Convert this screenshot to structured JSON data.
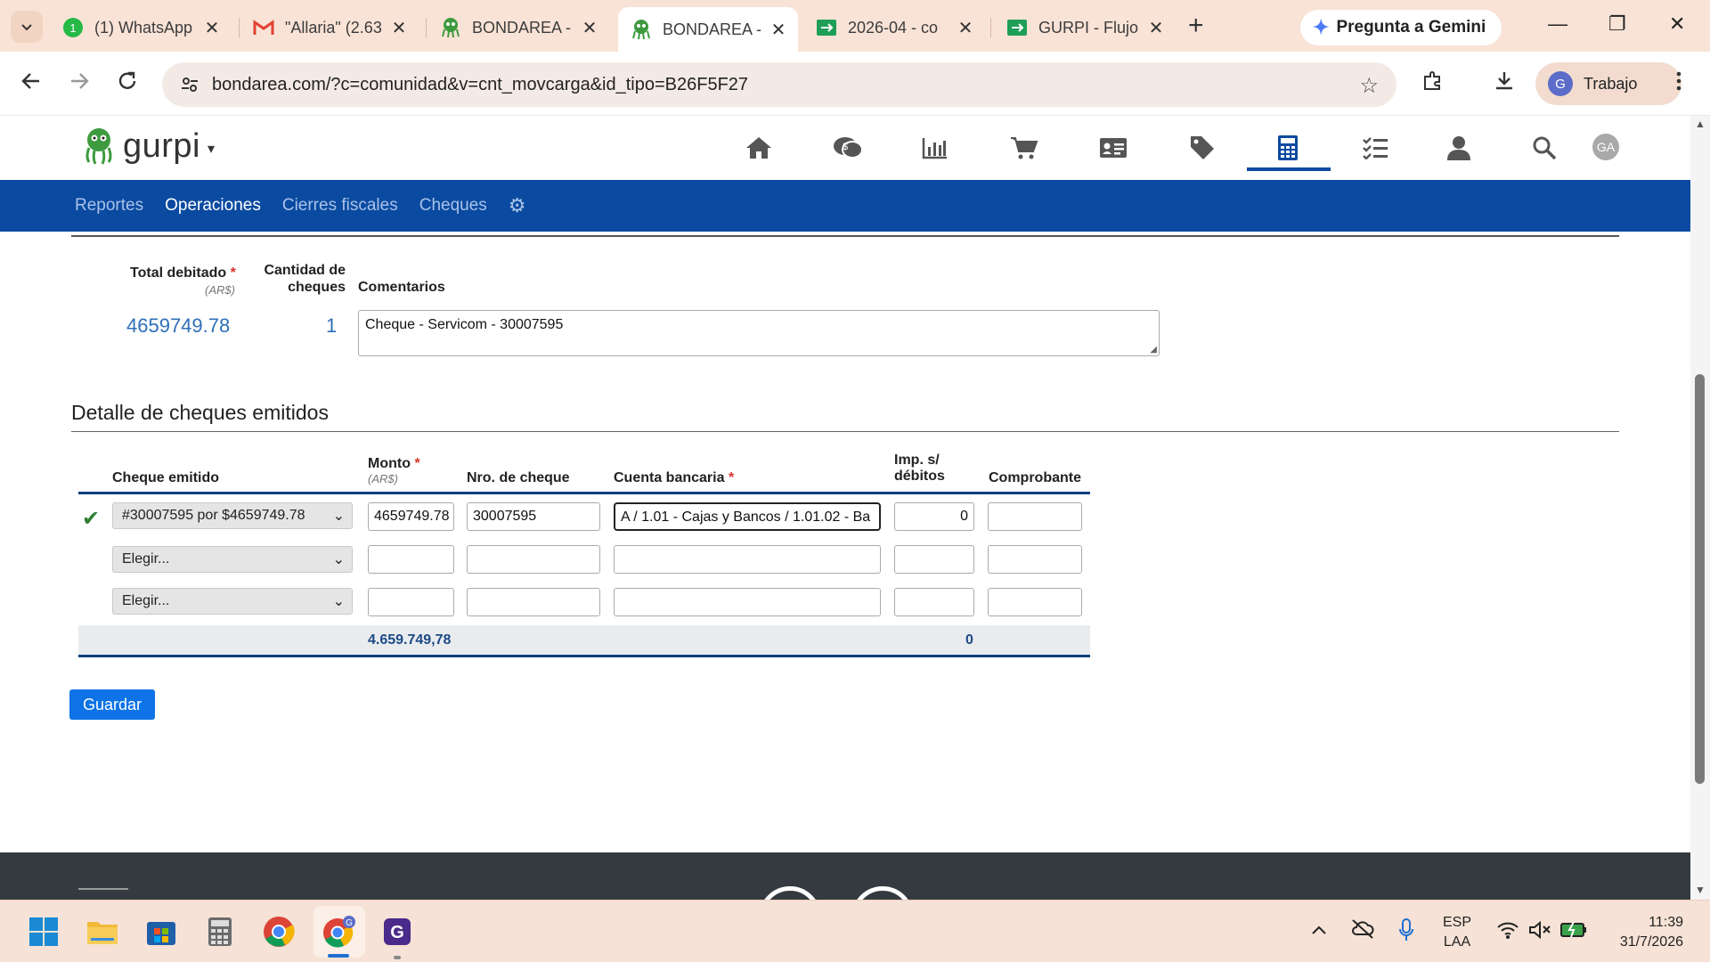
{
  "browser": {
    "tabs": [
      {
        "title": "(1) WhatsApp",
        "icon": "whatsapp-icon",
        "active": false
      },
      {
        "title": "\"Allaria\" (2.63",
        "icon": "gmail-icon",
        "active": false
      },
      {
        "title": "BONDAREA -",
        "icon": "bondarea-icon",
        "active": false
      },
      {
        "title": "BONDAREA -",
        "icon": "bondarea-icon",
        "active": true
      },
      {
        "title": "2026-04 - co",
        "icon": "sheets-icon",
        "active": false
      },
      {
        "title": "GURPI - Flujo",
        "icon": "sheets-icon",
        "active": false
      }
    ],
    "gemini_label": "Pregunta a Gemini",
    "url": "bondarea.com/?c=comunidad&v=cnt_movcarga&id_tipo=B26F5F27",
    "profile_label": "Trabajo",
    "profile_initial": "G"
  },
  "app": {
    "brand": "gurpi",
    "avatar_initials": "GA",
    "header_icons": [
      "home-icon",
      "chat-money-icon",
      "bar-chart-icon",
      "cart-icon",
      "id-card-icon",
      "tag-icon",
      "calculator-icon",
      "checklist-icon",
      "user-icon",
      "search-icon"
    ],
    "active_header_icon": "calculator-icon",
    "subnav": [
      {
        "label": "Reportes",
        "active": false
      },
      {
        "label": "Operaciones",
        "active": true
      },
      {
        "label": "Cierres fiscales",
        "active": false
      },
      {
        "label": "Cheques",
        "active": false
      }
    ]
  },
  "summary": {
    "total_label": "Total debitado",
    "total_unit": "(AR$)",
    "count_label_1": "Cantidad de",
    "count_label_2": "cheques",
    "comments_label": "Comentarios",
    "total_value": "4659749.78",
    "count_value": "1",
    "comment": "Cheque - Servicom - 30007595"
  },
  "detail": {
    "section_title": "Detalle de cheques emitidos",
    "headers": {
      "cheque": "Cheque emitido",
      "monto": "Monto",
      "monto_unit": "(AR$)",
      "nro": "Nro. de cheque",
      "cuenta": "Cuenta bancaria",
      "imp_1": "Imp. s/",
      "imp_2": "débitos",
      "comprobante": "Comprobante"
    },
    "rows": [
      {
        "cheque": "#30007595 por $4659749.78",
        "monto": "4659749.78",
        "nro": "30007595",
        "cuenta": "A / 1.01 - Cajas y Bancos / 1.01.02 - Ba",
        "imp": "0",
        "comprobante": ""
      },
      {
        "cheque": "Elegir...",
        "monto": "",
        "nro": "",
        "cuenta": "",
        "imp": "",
        "comprobante": ""
      },
      {
        "cheque": "Elegir...",
        "monto": "",
        "nro": "",
        "cuenta": "",
        "imp": "",
        "comprobante": ""
      }
    ],
    "total_monto": "4.659.749,78",
    "total_imp": "0"
  },
  "save_label": "Guardar",
  "taskbar": {
    "lang_1": "ESP",
    "lang_2": "LAA",
    "time": "11:39",
    "date": "31/7/2026"
  },
  "colors": {
    "subnav_bg": "#0a4aa0",
    "accent_blue": "#0d73e6",
    "value_blue": "#2f6fb8",
    "required_red": "#d9342b",
    "check_green": "#2e7d32",
    "tabstrip_bg": "#f9e3d6"
  }
}
